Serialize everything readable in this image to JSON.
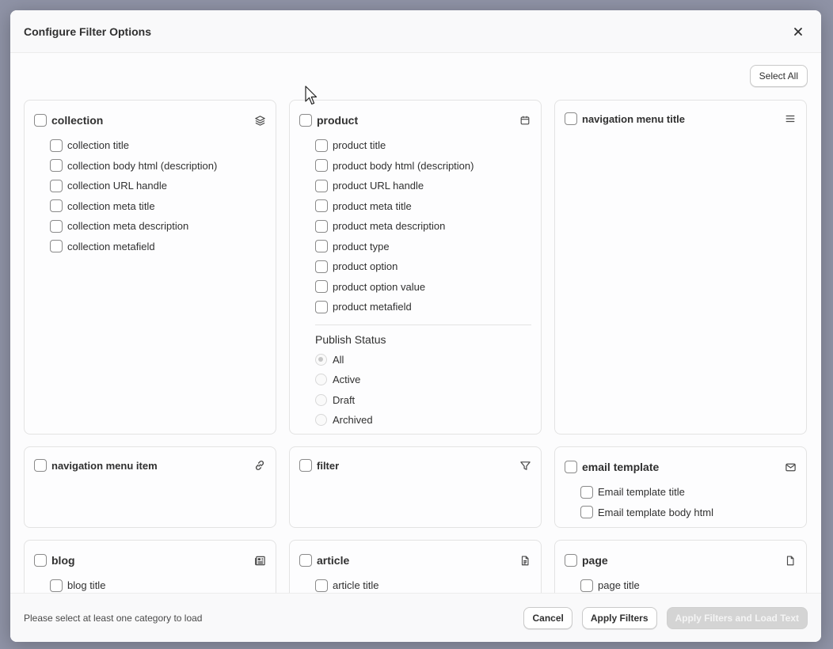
{
  "modal": {
    "title": "Configure Filter Options",
    "close_label": "×",
    "select_all_label": "Select All"
  },
  "cards": {
    "collection": {
      "title": "collection",
      "icon": "layers-icon",
      "items": [
        "collection title",
        "collection body html (description)",
        "collection URL handle",
        "collection meta title",
        "collection meta description",
        "collection metafield"
      ]
    },
    "product": {
      "title": "product",
      "icon": "calendar-icon",
      "items": [
        "product title",
        "product body html (description)",
        "product URL handle",
        "product meta title",
        "product meta description",
        "product type",
        "product option",
        "product option value",
        "product metafield"
      ],
      "publish_status": {
        "title": "Publish Status",
        "options": [
          "All",
          "Active",
          "Draft",
          "Archived"
        ],
        "selected": "All"
      }
    },
    "navigation_menu_title": {
      "title": "navigation menu title",
      "icon": "menu-icon"
    },
    "navigation_menu_item": {
      "title": "navigation menu item",
      "icon": "link-icon"
    },
    "filter": {
      "title": "filter",
      "icon": "filter-icon"
    },
    "email_template": {
      "title": "email template",
      "icon": "mail-icon",
      "items": [
        "Email template title",
        "Email template body html"
      ]
    },
    "blog": {
      "title": "blog",
      "icon": "newspaper-icon",
      "items": [
        "blog title"
      ]
    },
    "article": {
      "title": "article",
      "icon": "document-icon",
      "items": [
        "article title"
      ]
    },
    "page": {
      "title": "page",
      "icon": "page-icon",
      "items": [
        "page title"
      ]
    }
  },
  "footer": {
    "message": "Please select at least one category to load",
    "cancel_label": "Cancel",
    "apply_label": "Apply Filters",
    "apply_load_label": "Apply Filters and Load Text"
  }
}
